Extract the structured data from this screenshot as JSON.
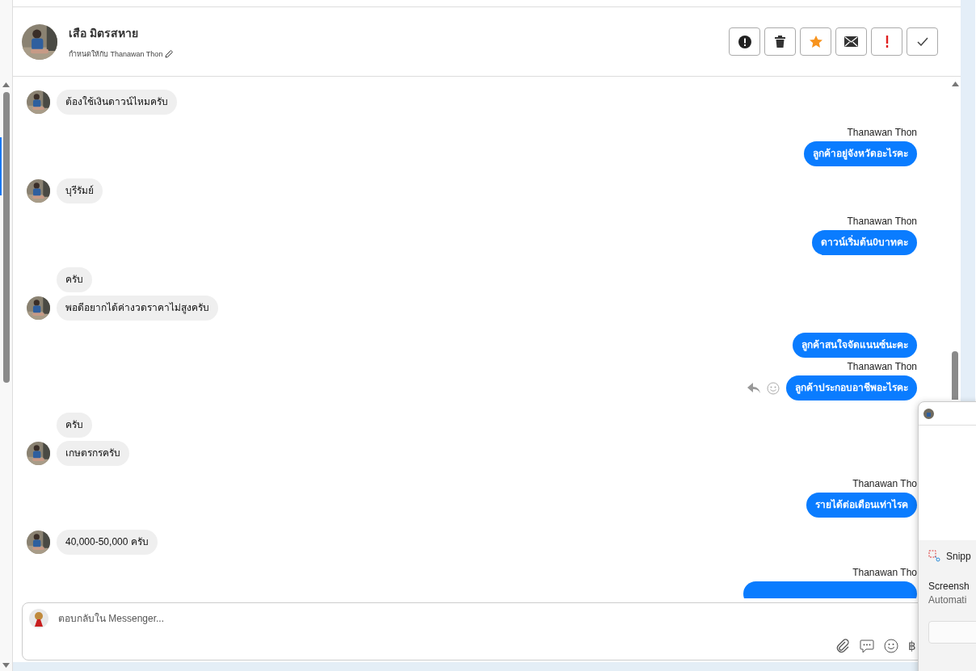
{
  "header": {
    "name": "เสือ มิตรสหาย",
    "assigned": "กำหนดให้กับ Thanawan Thon",
    "actions": [
      {
        "kind": "warning"
      },
      {
        "kind": "delete"
      },
      {
        "kind": "star"
      },
      {
        "kind": "mail"
      },
      {
        "kind": "important"
      },
      {
        "kind": "done"
      }
    ]
  },
  "messages": [
    {
      "kind": "in",
      "avatar": true,
      "text": "ต้องใช้เงินดาวน์ไหมครับ"
    },
    {
      "kind": "out",
      "sender": "Thanawan Thon",
      "text": "ลูกค้าอยู่จังหวัดอะไรคะ"
    },
    {
      "kind": "in",
      "avatar": true,
      "text": "บุรีรัมย์"
    },
    {
      "kind": "out",
      "sender": "Thanawan Thon",
      "text": "ดาวน์เริ่มต้น0บาทคะ"
    },
    {
      "kind": "in",
      "avatar": false,
      "text": "ครับ"
    },
    {
      "kind": "in",
      "avatar": true,
      "text": "พอดีอยากได้ค่างวดราคาไม่สูงครับ"
    },
    {
      "kind": "out",
      "text": "ลูกค้าสนใจจัดแนนซ์นะคะ"
    },
    {
      "kind": "out",
      "sender": "Thanawan Thon",
      "text": "ลูกค้าประกอบอาชีพอะไรคะ",
      "reactions": true
    },
    {
      "kind": "in",
      "avatar": false,
      "text": "ครับ"
    },
    {
      "kind": "in",
      "avatar": true,
      "text": "เกษตรกรครับ"
    },
    {
      "kind": "out",
      "sender": "Thanawan Tho",
      "text": "รายได้ต่อเดือนเท่าไรค"
    },
    {
      "kind": "in",
      "avatar": true,
      "text": "40,000-50,000 ครับ"
    },
    {
      "kind": "out",
      "sender": "Thanawan Tho"
    }
  ],
  "composer": {
    "placeholder": "ตอบกลับใน Messenger...",
    "currency": "฿"
  },
  "notification": {
    "app": "Snipp",
    "title": "Screensh",
    "body": "Automati"
  }
}
